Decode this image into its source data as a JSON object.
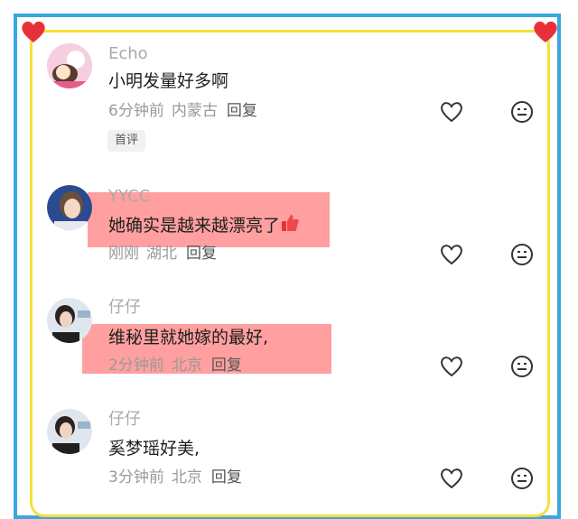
{
  "comments": [
    {
      "username": "Echo",
      "text": "小明发量好多啊",
      "time": "6分钟前",
      "location": "内蒙古",
      "reply": "回复",
      "badge": "首评"
    },
    {
      "username": "YYCC",
      "text": "她确实是越来越漂亮了",
      "time": "刚刚",
      "location": "湖北",
      "reply": "回复"
    },
    {
      "username": "仔仔",
      "text": "维秘里就她嫁的最好,",
      "time": "2分钟前",
      "location": "北京",
      "reply": "回复"
    },
    {
      "username": "仔仔",
      "text": "奚梦瑶好美,",
      "time": "3分钟前",
      "location": "北京",
      "reply": "回复"
    }
  ],
  "colors": {
    "frame_blue": "#3aa6dc",
    "frame_yellow": "#f4e03a",
    "heart": "#e8303a",
    "highlight": "#ff6464"
  }
}
